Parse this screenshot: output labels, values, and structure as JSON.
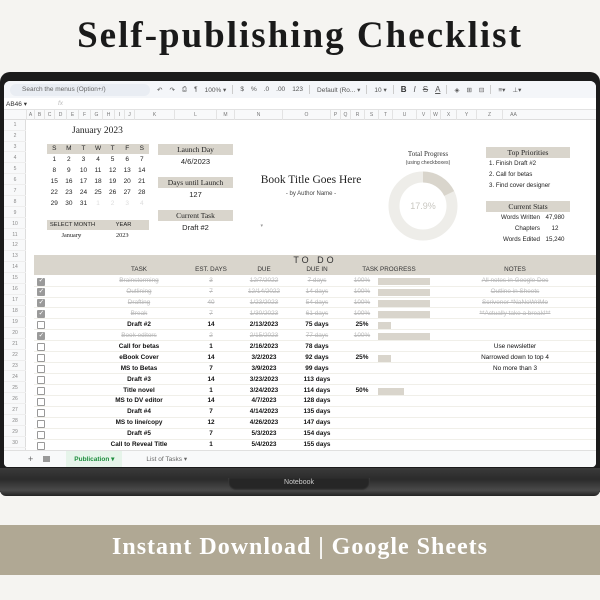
{
  "hero": {
    "title": "Self-publishing Checklist"
  },
  "toolbar": {
    "search_placeholder": "Search the menus (Option+/)",
    "zoom": "100%",
    "currency": "$",
    "percent": "%",
    "decimal_dec": ".0",
    "decimal_inc": ".00",
    "number_format": "123",
    "font": "Default (Ro...",
    "font_size": "10",
    "bold": "B",
    "italic": "I",
    "strike": "S",
    "text_color": "A"
  },
  "formula_bar": {
    "cell_ref": "AB46",
    "fx": "fx",
    "value": ""
  },
  "columns": [
    "A",
    "B",
    "C",
    "D",
    "E",
    "F",
    "G",
    "H",
    "I",
    "J",
    "K",
    "L",
    "M",
    "N",
    "O",
    "P",
    "Q",
    "R",
    "S",
    "T",
    "U",
    "V",
    "W",
    "X",
    "Y",
    "Z",
    "AA"
  ],
  "rows": [
    "1",
    "2",
    "3",
    "4",
    "5",
    "6",
    "7",
    "8",
    "9",
    "10",
    "11",
    "12",
    "13",
    "14",
    "15",
    "16",
    "17",
    "18",
    "19",
    "20",
    "21",
    "22",
    "23",
    "24",
    "25",
    "26",
    "27",
    "28",
    "29",
    "30"
  ],
  "calendar": {
    "title": "January 2023",
    "weekdays": [
      "S",
      "M",
      "T",
      "W",
      "T",
      "F",
      "S"
    ],
    "weeks": [
      [
        "1",
        "2",
        "3",
        "4",
        "5",
        "6",
        "7"
      ],
      [
        "8",
        "9",
        "10",
        "11",
        "12",
        "13",
        "14"
      ],
      [
        "15",
        "16",
        "17",
        "18",
        "19",
        "20",
        "21"
      ],
      [
        "22",
        "23",
        "24",
        "25",
        "26",
        "27",
        "28"
      ],
      [
        "29",
        "30",
        "31",
        "1",
        "2",
        "3",
        "4"
      ]
    ],
    "select_month_label": "SELECT MONTH",
    "year_label": "YEAR",
    "selected_month": "January",
    "selected_year": "2023"
  },
  "launch": {
    "launch_day_label": "Launch Day",
    "launch_day": "4/6/2023",
    "days_until_label": "Days until Launch",
    "days_until": "127",
    "current_task_label": "Current Task",
    "current_task": "Draft #2"
  },
  "book": {
    "title": "Book Title Goes Here",
    "author": "- by Author Name -"
  },
  "progress": {
    "title": "Total Progress",
    "subtitle": "(using checkboxes)",
    "percent_label": "17.9%",
    "fraction": 0.179
  },
  "priorities": {
    "title": "Top Priorities",
    "items": [
      "1.  Finish Draft #2",
      "2.  Call for betas",
      "3.  Find cover designer"
    ]
  },
  "stats": {
    "title": "Current Stats",
    "items": [
      {
        "label": "Words Written",
        "value": "47,980"
      },
      {
        "label": "Chapters",
        "value": "12"
      },
      {
        "label": "Words Edited",
        "value": "15,240"
      }
    ]
  },
  "todo": {
    "title": "TO DO",
    "headers": {
      "task": "TASK",
      "est_days": "EST. DAYS",
      "due": "DUE",
      "due_in": "DUE IN",
      "progress": "TASK PROGRESS",
      "notes": "NOTES"
    },
    "rows": [
      {
        "done": true,
        "task": "Brainstorming",
        "est": "3",
        "due": "12/7/2022",
        "due_in": "7 days",
        "pct": "100%",
        "progress": 1.0,
        "note": "All notes in Google Doc"
      },
      {
        "done": true,
        "task": "Outlining",
        "est": "7",
        "due": "12/14/2022",
        "due_in": "14 days",
        "pct": "100%",
        "progress": 1.0,
        "note": "Outline in Sheets"
      },
      {
        "done": true,
        "task": "Drafting",
        "est": "40",
        "due": "1/23/2023",
        "due_in": "54 days",
        "pct": "100%",
        "progress": 1.0,
        "note": "Scrivener *NaNoWriMo"
      },
      {
        "done": true,
        "task": "Break",
        "est": "7",
        "due": "1/30/2023",
        "due_in": "61 days",
        "pct": "100%",
        "progress": 1.0,
        "note": "**Actually take a break!**"
      },
      {
        "done": false,
        "task": "Draft #2",
        "est": "14",
        "due": "2/13/2023",
        "due_in": "75 days",
        "pct": "25%",
        "progress": 0.25,
        "note": ""
      },
      {
        "done": true,
        "task": "Book editors",
        "est": "2",
        "due": "2/15/2023",
        "due_in": "77 days",
        "pct": "100%",
        "progress": 1.0,
        "note": ""
      },
      {
        "done": false,
        "task": "Call for betas",
        "est": "1",
        "due": "2/16/2023",
        "due_in": "78 days",
        "pct": "",
        "progress": 0,
        "note": "Use newsletter"
      },
      {
        "done": false,
        "task": "eBook Cover",
        "est": "14",
        "due": "3/2/2023",
        "due_in": "92 days",
        "pct": "25%",
        "progress": 0.25,
        "note": "Narrowed down to top 4"
      },
      {
        "done": false,
        "task": "MS to Betas",
        "est": "7",
        "due": "3/9/2023",
        "due_in": "99 days",
        "pct": "",
        "progress": 0,
        "note": "No more than 3"
      },
      {
        "done": false,
        "task": "Draft #3",
        "est": "14",
        "due": "3/23/2023",
        "due_in": "113 days",
        "pct": "",
        "progress": 0,
        "note": ""
      },
      {
        "done": false,
        "task": "Title novel",
        "est": "1",
        "due": "3/24/2023",
        "due_in": "114 days",
        "pct": "50%",
        "progress": 0.5,
        "note": ""
      },
      {
        "done": false,
        "task": "MS to DV editor",
        "est": "14",
        "due": "4/7/2023",
        "due_in": "128 days",
        "pct": "",
        "progress": 0,
        "note": ""
      },
      {
        "done": false,
        "task": "Draft #4",
        "est": "7",
        "due": "4/14/2023",
        "due_in": "135 days",
        "pct": "",
        "progress": 0,
        "note": ""
      },
      {
        "done": false,
        "task": "MS to line/copy",
        "est": "12",
        "due": "4/26/2023",
        "due_in": "147 days",
        "pct": "",
        "progress": 0,
        "note": ""
      },
      {
        "done": false,
        "task": "Draft #5",
        "est": "7",
        "due": "5/3/2023",
        "due_in": "154 days",
        "pct": "",
        "progress": 0,
        "note": ""
      },
      {
        "done": false,
        "task": "Call to Reveal Title",
        "est": "1",
        "due": "5/4/2023",
        "due_in": "155 days",
        "pct": "",
        "progress": 0,
        "note": ""
      }
    ]
  },
  "tabs": [
    {
      "label": "Publication ▾",
      "active": true
    },
    {
      "label": "List of Tasks ▾",
      "active": false
    }
  ],
  "device_label": "Notebook",
  "banner": {
    "text": "Instant Download | Google Sheets"
  },
  "colors": {
    "accent": "#d9d5cc",
    "banner": "#b0a894",
    "tab_active": "#1e8e3e"
  }
}
